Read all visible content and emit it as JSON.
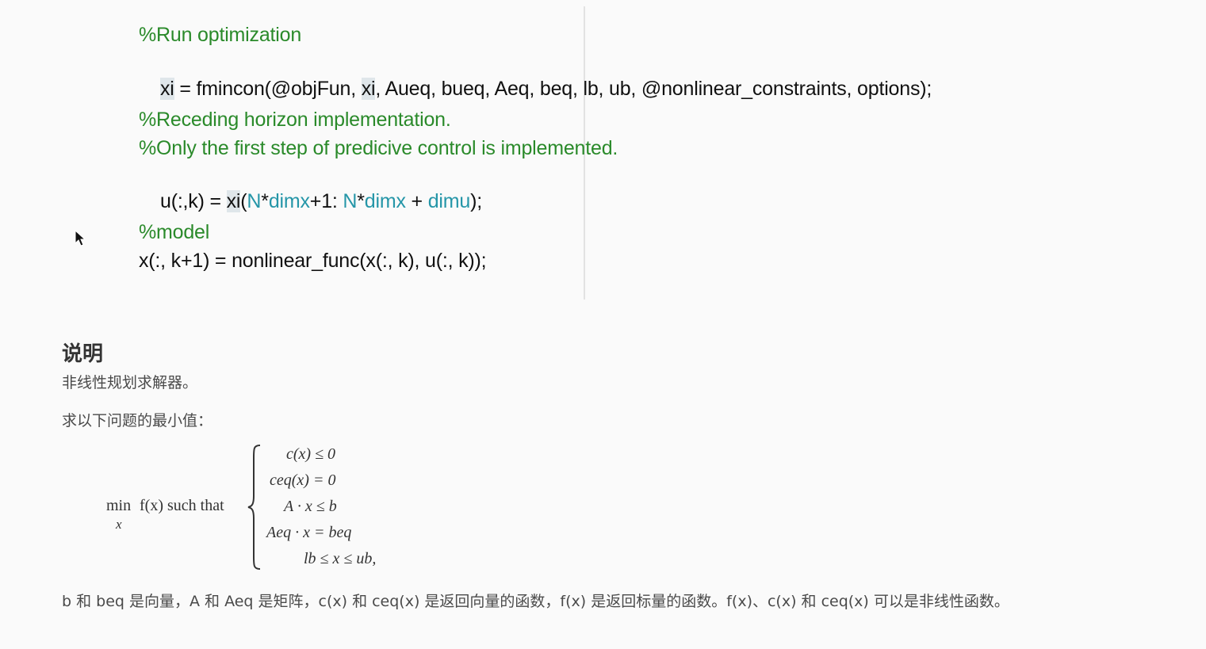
{
  "code": {
    "comment_run": "%Run optimization",
    "line_fmincon": {
      "lhs": "xi",
      "mid1": " = fmincon(@objFun, ",
      "arg": "xi",
      "rest": ", Aueq, bueq, Aeq, beq, lb, ub, @nonlinear_constraints, options);"
    },
    "comment_receding": "%Receding horizon implementation.",
    "comment_first_step": "%Only the first step of predicive control is implemented.",
    "line_u": {
      "lhs": "u(:,k) = ",
      "xi": "xi",
      "open": "(",
      "N1": "N",
      "star1": "*",
      "dimx1": "dimx",
      "plus1": "+1: ",
      "N2": "N",
      "star2": "*",
      "dimx2": "dimx",
      "plus2": " + ",
      "dimu": "dimu",
      "close": ");"
    },
    "comment_model": "%model",
    "line_model": "x(:, k+1) = nonlinear_func(x(:, k), u(:, k));"
  },
  "cursor": {
    "icon": "mouse-pointer-icon"
  },
  "doc": {
    "heading": "说明",
    "subtitle": "非线性规划求解器。",
    "intro": "求以下问题的最小值：",
    "formula": {
      "min": "min",
      "min_sub": "x",
      "objective": "f(x) such that",
      "constraints": [
        "c(x) ≤ 0",
        "ceq(x) = 0",
        "A · x ≤ b",
        "Aeq · x = beq",
        "lb ≤ x ≤ ub,"
      ]
    },
    "description": "b 和 beq 是向量，A 和 Aeq 是矩阵，c(x) 和 ceq(x) 是返回向量的函数，f(x) 是返回标量的函数。f(x)、c(x) 和 ceq(x) 可以是非线性函数。"
  },
  "colors": {
    "comment": "#2a8a2a",
    "variable": "#2596a8",
    "highlight": "#dfe6ea",
    "background": "#fafafa"
  }
}
